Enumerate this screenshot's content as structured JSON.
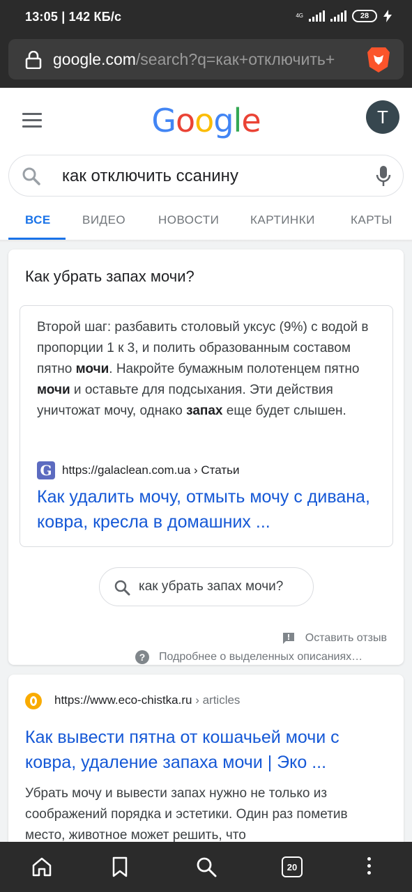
{
  "status_bar": {
    "time_speed": "13:05 | 142 КБ/с",
    "network": "4G",
    "battery": "28"
  },
  "browser": {
    "url_domain": "google.com",
    "url_path": "/search?q=как+отключить+",
    "open_tabs": "20"
  },
  "google": {
    "avatar_letter": "T",
    "query": "как отключить ссанину",
    "tabs": [
      "ВСЕ",
      "ВИДЕО",
      "НОВОСТИ",
      "КАРТИНКИ",
      "КАРТЫ"
    ]
  },
  "featured": {
    "question": "Как убрать запах мочи?",
    "snippet_parts": {
      "p1": "Второй шаг: разбавить столовый уксус (9%) с водой в пропорции 1 к 3, и полить образованным составом пятно ",
      "b1": "мочи",
      "p2": ". Накройте бумажным полотенцем пятно ",
      "b2": "мочи",
      "p3": " и оставьте для подсыхания. Эти действия уничтожат мочу, однако ",
      "b3": "запах",
      "p4": " еще будет слышен."
    },
    "source": "https://galaclean.com.ua › Статьи",
    "link_title": "Как удалить мочу, отмыть мочу с дивана, ковра, кресла в домашних ...",
    "related_query": "как убрать запах мочи?",
    "feedback": "Оставить отзыв",
    "about": "Подробнее о выделенных описаниях…"
  },
  "result2": {
    "url": "https://www.eco-chistka.ru",
    "crumb": " › articles",
    "title": "Как вывести пятна от кошачьей мочи с ковра, удаление запаха мочи | Эко ...",
    "desc": "Убрать мочу и вывести запах нужно не только из соображений порядка и эстетики. Один раз пометив место, животное может решить, что"
  },
  "colors": {
    "link": "#1558d6",
    "accent": "#1a73e8",
    "chrome_dark": "#2b2b2b"
  }
}
